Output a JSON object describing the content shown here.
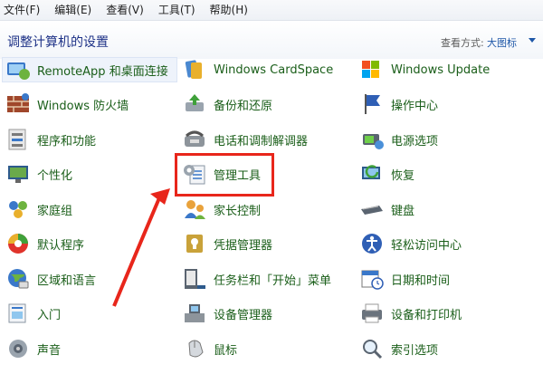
{
  "menu": [
    "文件(F)",
    "编辑(E)",
    "查看(V)",
    "工具(T)",
    "帮助(H)"
  ],
  "header": {
    "title": "调整计算机的设置",
    "view_label": "查看方式:",
    "view_value": "大图标"
  },
  "items": [
    {
      "label": "RemoteApp 和桌面连接",
      "icon": "remoteapp-icon"
    },
    {
      "label": "Windows CardSpace",
      "icon": "cardspace-icon"
    },
    {
      "label": "Windows Update",
      "icon": "windows-update-icon"
    },
    {
      "label": "Windows 防火墙",
      "icon": "firewall-icon"
    },
    {
      "label": "备份和还原",
      "icon": "backup-icon"
    },
    {
      "label": "操作中心",
      "icon": "action-center-flag-icon"
    },
    {
      "label": "程序和功能",
      "icon": "programs-icon"
    },
    {
      "label": "电话和调制解调器",
      "icon": "phone-modem-icon"
    },
    {
      "label": "电源选项",
      "icon": "power-options-icon"
    },
    {
      "label": "个性化",
      "icon": "personalization-icon"
    },
    {
      "label": "管理工具",
      "icon": "admin-tools-icon"
    },
    {
      "label": "恢复",
      "icon": "recovery-icon"
    },
    {
      "label": "家庭组",
      "icon": "homegroup-icon"
    },
    {
      "label": "家长控制",
      "icon": "parental-controls-icon"
    },
    {
      "label": "键盘",
      "icon": "keyboard-icon"
    },
    {
      "label": "默认程序",
      "icon": "default-programs-icon"
    },
    {
      "label": "凭据管理器",
      "icon": "credential-manager-icon"
    },
    {
      "label": "轻松访问中心",
      "icon": "ease-of-access-icon"
    },
    {
      "label": "区域和语言",
      "icon": "region-language-icon"
    },
    {
      "label": "任务栏和「开始」菜单",
      "icon": "taskbar-start-menu-icon"
    },
    {
      "label": "日期和时间",
      "icon": "date-time-icon"
    },
    {
      "label": "入门",
      "icon": "getting-started-icon"
    },
    {
      "label": "设备管理器",
      "icon": "device-manager-icon"
    },
    {
      "label": "设备和打印机",
      "icon": "devices-printers-icon"
    },
    {
      "label": "声音",
      "icon": "sound-icon"
    },
    {
      "label": "鼠标",
      "icon": "mouse-icon"
    },
    {
      "label": "索引选项",
      "icon": "indexing-options-icon"
    }
  ],
  "colors": {
    "link_green": "#1a5e19",
    "title_blue": "#1e3287",
    "highlight_red": "#e8261b"
  }
}
